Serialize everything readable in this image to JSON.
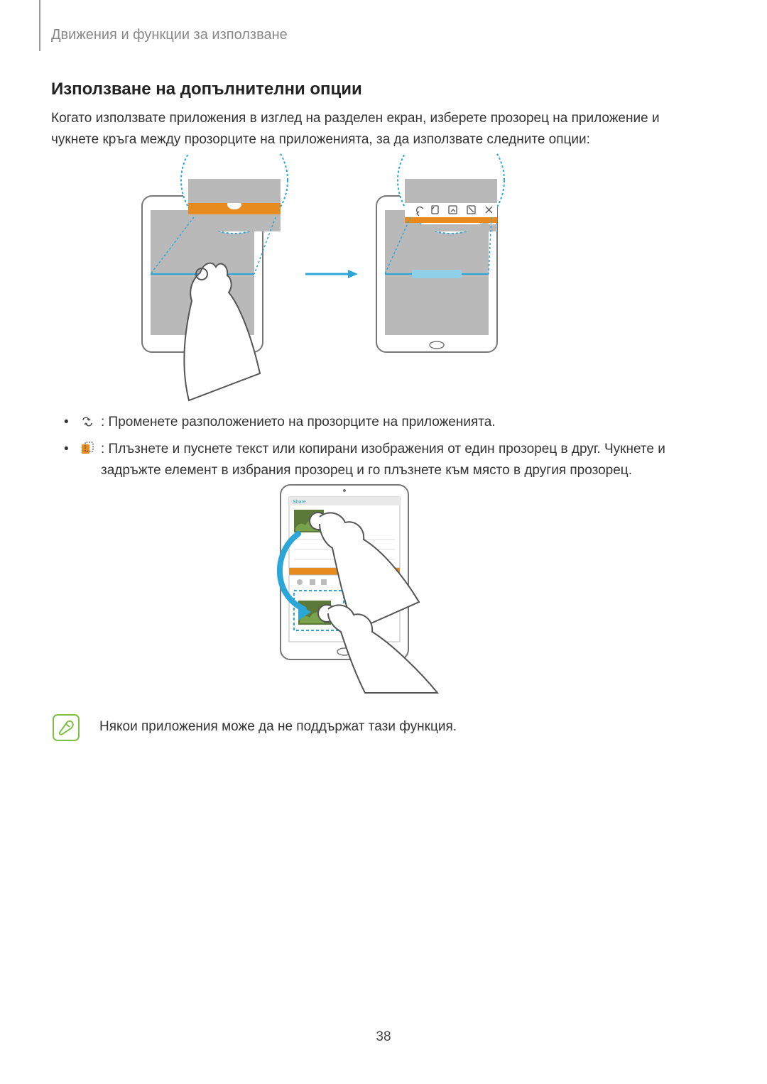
{
  "breadcrumb": "Движения и функции за използване",
  "section_title": "Използване на допълнителни опции",
  "intro": "Когато използвате приложения в изглед на разделен екран, изберете прозорец на приложение и чукнете кръга между прозорците на приложенията, за да използвате следните опции:",
  "bullet1": " : Променете разположението на прозорците на приложенията.",
  "bullet2": " : Плъзнете и пуснете текст или копирани изображения от един прозорец в друг. Чукнете и задръжте елемент в избрания прозорец и го плъзнете към място в другия прозорец.",
  "note": "Някои приложения може да не поддържат тази функция.",
  "page_number": "38"
}
